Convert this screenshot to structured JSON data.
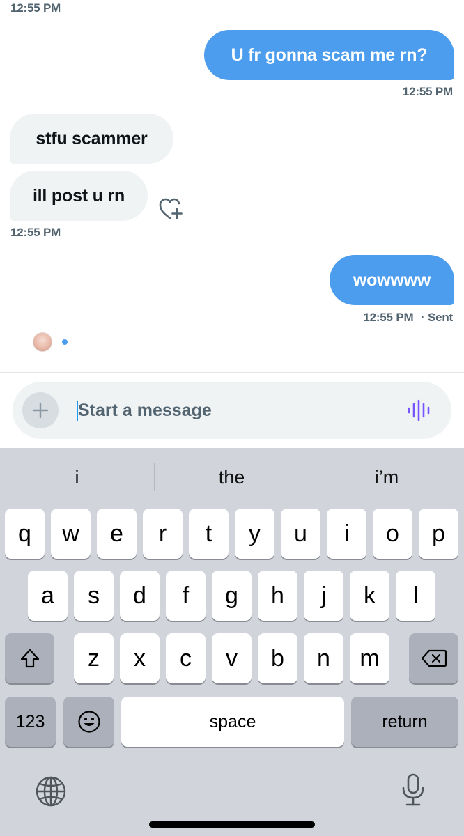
{
  "messages": [
    {
      "kind": "timestamp",
      "text": "12:55 PM"
    },
    {
      "kind": "outgoing",
      "text": "U fr gonna scam me rn?"
    },
    {
      "kind": "timestamp",
      "text": "12:55 PM"
    },
    {
      "kind": "incoming",
      "text": "stfu scammer"
    },
    {
      "kind": "incoming",
      "text": "ill post u rn"
    },
    {
      "kind": "timestamp",
      "text": "12:55 PM"
    },
    {
      "kind": "outgoing",
      "text": "wowwww"
    },
    {
      "kind": "timestamp",
      "text": "12:55 PM"
    }
  ],
  "sent_status": "· Sent",
  "icons": {
    "reaction": "heart-plus-icon",
    "add_media": "plus-icon",
    "voice": "voice-waveform-icon",
    "shift": "shift-arrow-icon",
    "delete": "backspace-icon",
    "emoji": "emoji-icon",
    "globe": "globe-icon",
    "dictation": "microphone-icon"
  },
  "composer": {
    "placeholder": "Start a message"
  },
  "keyboard": {
    "suggestions": [
      "i",
      "the",
      "i’m"
    ],
    "row1": [
      "q",
      "w",
      "e",
      "r",
      "t",
      "y",
      "u",
      "i",
      "o",
      "p"
    ],
    "row2": [
      "a",
      "s",
      "d",
      "f",
      "g",
      "h",
      "j",
      "k",
      "l"
    ],
    "row3": [
      "z",
      "x",
      "c",
      "v",
      "b",
      "n",
      "m"
    ],
    "numbers_key": "123",
    "space_key": "space",
    "return_key": "return"
  },
  "colors": {
    "outgoing_bubble": "#4c9ded",
    "incoming_bubble": "#eff3f4",
    "timestamp": "#536471",
    "voice_accent": "#7856ff",
    "keyboard_bg": "#d1d4db"
  }
}
